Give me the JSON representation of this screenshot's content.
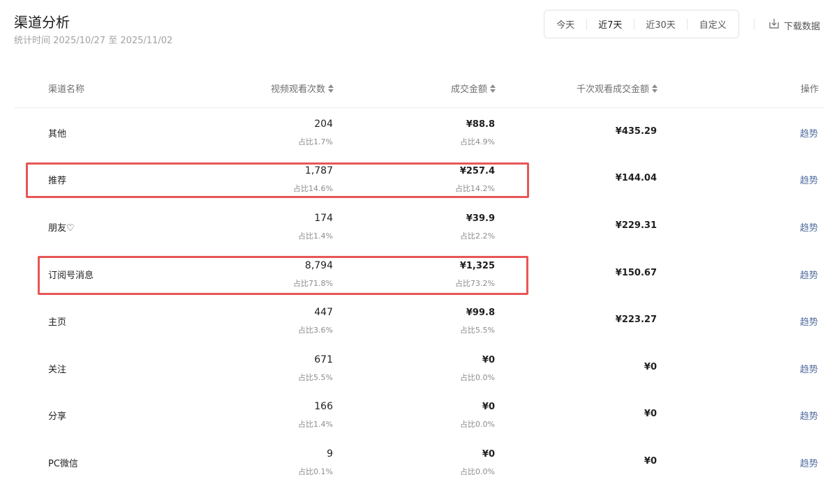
{
  "header": {
    "title": "渠道分析",
    "subtitle": "统计时间 2025/10/27 至 2025/11/02",
    "range_tabs": [
      "今天",
      "近7天",
      "近30天",
      "自定义"
    ],
    "active_tab": "近7天",
    "download_label": "下载数据"
  },
  "table": {
    "columns": {
      "name": "渠道名称",
      "views": "视频观看次数",
      "amount": "成交金额",
      "per_k": "千次观看成交金额",
      "ops": "操作"
    },
    "rows": [
      {
        "name": "其他",
        "views": "204",
        "views_pct": "占比1.7%",
        "amount": "¥88.8",
        "amount_pct": "占比4.9%",
        "per_k": "¥435.29",
        "action": "趋势",
        "highlighted": false
      },
      {
        "name": "推荐",
        "views": "1,787",
        "views_pct": "占比14.6%",
        "amount": "¥257.4",
        "amount_pct": "占比14.2%",
        "per_k": "¥144.04",
        "action": "趋势",
        "highlighted": true
      },
      {
        "name": "朋友♡",
        "views": "174",
        "views_pct": "占比1.4%",
        "amount": "¥39.9",
        "amount_pct": "占比2.2%",
        "per_k": "¥229.31",
        "action": "趋势",
        "highlighted": false
      },
      {
        "name": "订阅号消息",
        "views": "8,794",
        "views_pct": "占比71.8%",
        "amount": "¥1,325",
        "amount_pct": "占比73.2%",
        "per_k": "¥150.67",
        "action": "趋势",
        "highlighted": true
      },
      {
        "name": "主页",
        "views": "447",
        "views_pct": "占比3.6%",
        "amount": "¥99.8",
        "amount_pct": "占比5.5%",
        "per_k": "¥223.27",
        "action": "趋势",
        "highlighted": false
      },
      {
        "name": "关注",
        "views": "671",
        "views_pct": "占比5.5%",
        "amount": "¥0",
        "amount_pct": "占比0.0%",
        "per_k": "¥0",
        "action": "趋势",
        "highlighted": false
      },
      {
        "name": "分享",
        "views": "166",
        "views_pct": "占比1.4%",
        "amount": "¥0",
        "amount_pct": "占比0.0%",
        "per_k": "¥0",
        "action": "趋势",
        "highlighted": false
      },
      {
        "name": "PC微信",
        "views": "9",
        "views_pct": "占比0.1%",
        "amount": "¥0",
        "amount_pct": "占比0.0%",
        "per_k": "¥0",
        "action": "趋势",
        "highlighted": false
      }
    ]
  },
  "colors": {
    "highlight_border": "#e85656",
    "link": "#516c9f"
  }
}
